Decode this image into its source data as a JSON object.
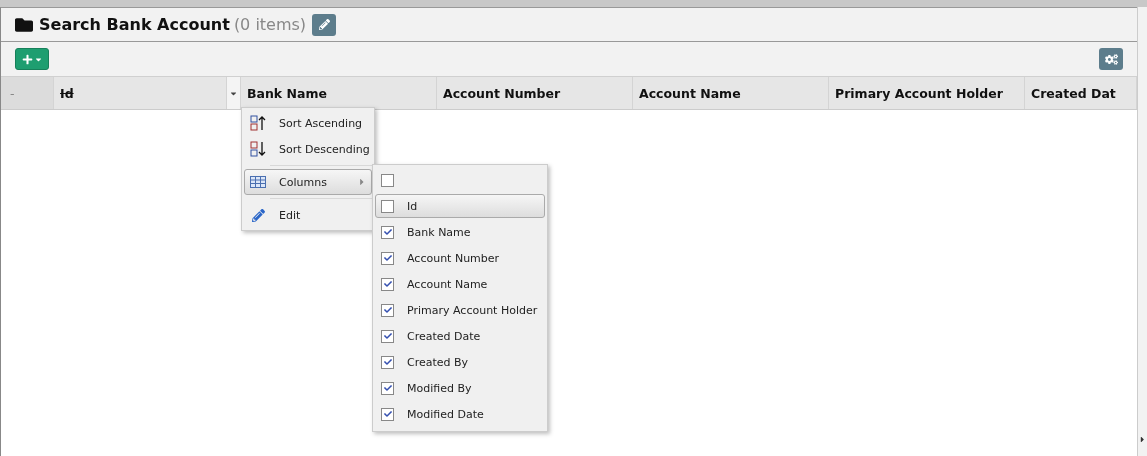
{
  "title": "Search Bank Account",
  "count": "(0 items)",
  "columns": [
    {
      "label": "-",
      "hidden": false,
      "menu_open": false
    },
    {
      "label": "Id",
      "hidden": true,
      "menu_open": true
    },
    {
      "label": "Bank Name",
      "hidden": false,
      "menu_open": false
    },
    {
      "label": "Account Number",
      "hidden": false,
      "menu_open": false
    },
    {
      "label": "Account Name",
      "hidden": false,
      "menu_open": false
    },
    {
      "label": "Primary Account Holder",
      "hidden": false,
      "menu_open": false
    },
    {
      "label": "Created Dat",
      "hidden": false,
      "menu_open": false
    }
  ],
  "menu": [
    {
      "kind": "sort-asc",
      "label": "Sort Ascending",
      "selected": false
    },
    {
      "kind": "sort-desc",
      "label": "Sort Descending",
      "selected": false
    },
    {
      "kind": "columns",
      "label": "Columns",
      "selected": true
    },
    {
      "kind": "edit",
      "label": "Edit",
      "selected": false
    }
  ],
  "column_options": [
    {
      "checked": false,
      "selected": false
    },
    {
      "label": "Id",
      "checked": false,
      "selected": true
    },
    {
      "label": "Bank Name",
      "checked": true,
      "selected": false
    },
    {
      "label": "Account Number",
      "checked": true,
      "selected": false
    },
    {
      "label": "Account Name",
      "checked": true,
      "selected": false
    },
    {
      "label": "Primary Account Holder",
      "checked": true,
      "selected": false
    },
    {
      "label": "Created Date",
      "checked": true,
      "selected": false
    },
    {
      "label": "Created By",
      "checked": true,
      "selected": false
    },
    {
      "label": "Modified By",
      "checked": true,
      "selected": false
    },
    {
      "label": "Modified Date",
      "checked": true,
      "selected": false
    }
  ]
}
